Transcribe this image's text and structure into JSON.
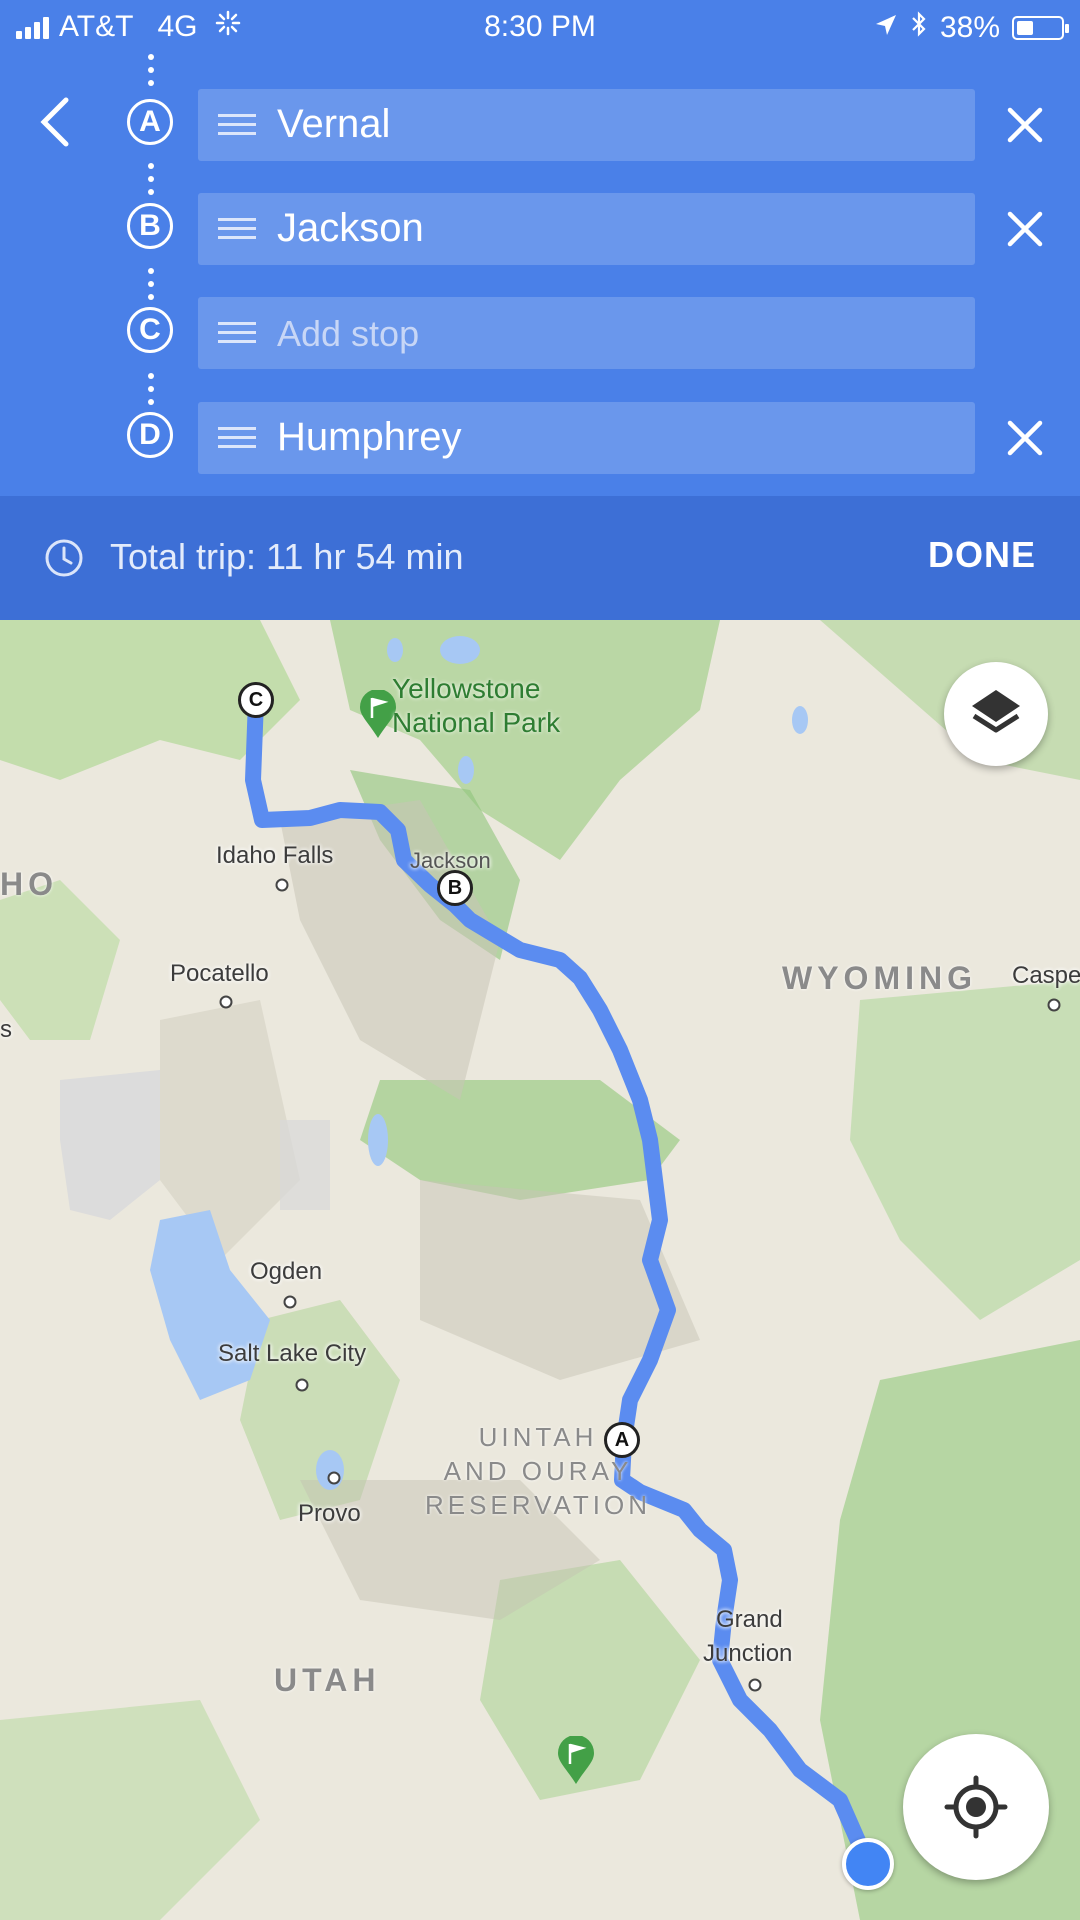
{
  "status_bar": {
    "carrier": "AT&T",
    "network": "4G",
    "time": "8:30 PM",
    "battery": "38%",
    "battery_level": 0.38
  },
  "stops": [
    {
      "marker": "A",
      "value": "Vernal",
      "placeholder": ""
    },
    {
      "marker": "B",
      "value": "Jackson",
      "placeholder": ""
    },
    {
      "marker": "C",
      "value": "",
      "placeholder": "Add stop"
    },
    {
      "marker": "D",
      "value": "Humphrey",
      "placeholder": ""
    }
  ],
  "trip": {
    "total": "Total trip: 11 hr 54 min",
    "done": "DONE"
  },
  "map": {
    "places": {
      "idaho_falls": "Idaho Falls",
      "pocatello": "Pocatello",
      "ogden": "Ogden",
      "salt_lake_city": "Salt Lake City",
      "provo": "Provo",
      "jackson": "Jackson",
      "grand_junction_1": "Grand",
      "grand_junction_2": "Junction",
      "casper": "Caspe",
      "ho": "HO",
      "s": "s"
    },
    "regions": {
      "wyoming": "WYOMING",
      "utah": "UTAH"
    },
    "reservation": {
      "line1": "UINTAH",
      "line2": "AND OURAY",
      "line3": "RESERVATION"
    },
    "park": {
      "line1": "Yellowstone",
      "line2": "National Park"
    },
    "route_markers": {
      "a": "A",
      "b": "B",
      "c": "C"
    },
    "route_color": "#5b8cf0"
  }
}
